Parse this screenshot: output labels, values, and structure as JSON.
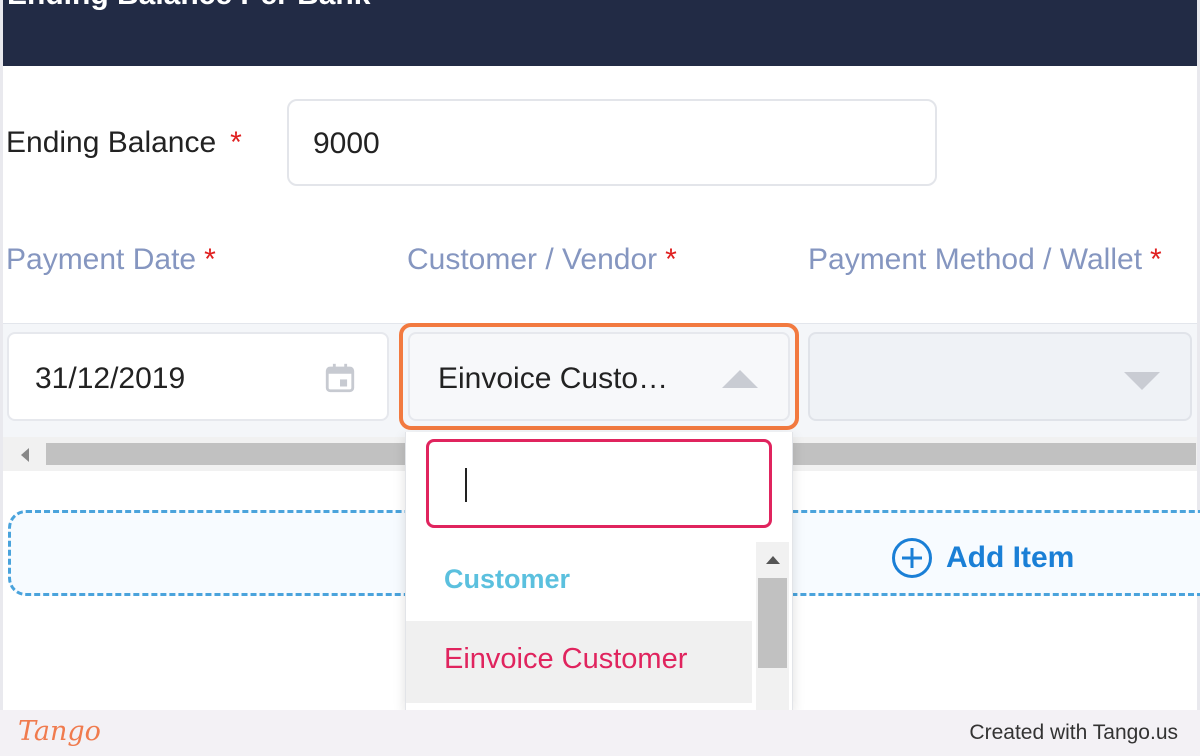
{
  "header": {
    "title": "Ending Balance Per Bank"
  },
  "ending_balance": {
    "label": "Ending Balance",
    "required_mark": "*",
    "value": "9000"
  },
  "columns": {
    "payment_date": {
      "label": "Payment Date",
      "required_mark": "*"
    },
    "customer_vendor": {
      "label": "Customer / Vendor",
      "required_mark": "*"
    },
    "payment_method": {
      "label": "Payment Method / Wallet",
      "required_mark": "*"
    }
  },
  "row": {
    "payment_date_value": "31/12/2019",
    "customer_value": "Einvoice Custo…",
    "payment_method_value": ""
  },
  "dropdown": {
    "search_value": "",
    "group_label": "Customer",
    "items": [
      "Einvoice Customer"
    ]
  },
  "add_item": {
    "label": "Add Item"
  },
  "footer": {
    "logo": "Tango",
    "credit": "Created with Tango.us"
  },
  "colors": {
    "header_bg": "#222b45",
    "label_blue": "#8596c0",
    "required_red": "#e02020",
    "highlight_orange": "#f27a40",
    "search_border": "#e0245e",
    "group_cyan": "#5bc0de",
    "add_item_blue": "#1a7fd6"
  }
}
